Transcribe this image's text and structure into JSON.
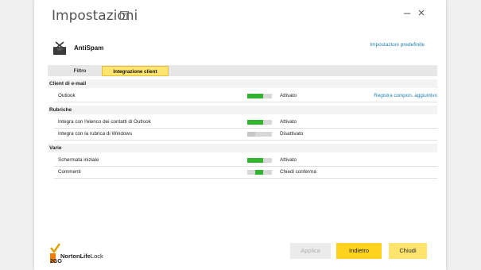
{
  "window": {
    "title": "Impostazioni",
    "help_icon": "?",
    "minimize_icon": "–",
    "close_icon": "×"
  },
  "product": {
    "name": "AntiSpam",
    "icon": "mail-envelope-icon",
    "defaults_link": "Impostazioni predefinite"
  },
  "tabs": [
    {
      "label": "Filtro",
      "active": false
    },
    {
      "label": "Integrazione client",
      "active": true
    }
  ],
  "sections": [
    {
      "title": "Client di e-mail",
      "rows": [
        {
          "label": "Outlook",
          "toggle": "on",
          "status": "Attivato",
          "link": "Registra compon. aggiuntivo"
        }
      ]
    },
    {
      "title": "Rubriche",
      "rows": [
        {
          "label": "Integra con l'elenco dei contatti di Outlook",
          "toggle": "on",
          "status": "Attivato"
        },
        {
          "label": "Integra con la rubrica di Windows",
          "toggle": "off",
          "status": "Disattivato"
        }
      ]
    },
    {
      "title": "Varie",
      "rows": [
        {
          "label": "Schermata iniziale",
          "toggle": "on",
          "status": "Attivato"
        },
        {
          "label": "Commenti",
          "toggle": "half",
          "status": "Chiedi conferma"
        }
      ]
    }
  ],
  "footer": {
    "logo_brand": "NortonLife",
    "logo_brand_light": "Lock",
    "logo_badge": "2GO",
    "buttons": {
      "apply": "Applica",
      "back": "Indietro",
      "close": "Chiudi"
    }
  },
  "colors": {
    "accent_yellow": "#ffd21f",
    "light_yellow": "#ffe46e",
    "toggle_on": "#32b431",
    "link": "#1f7fb5"
  }
}
